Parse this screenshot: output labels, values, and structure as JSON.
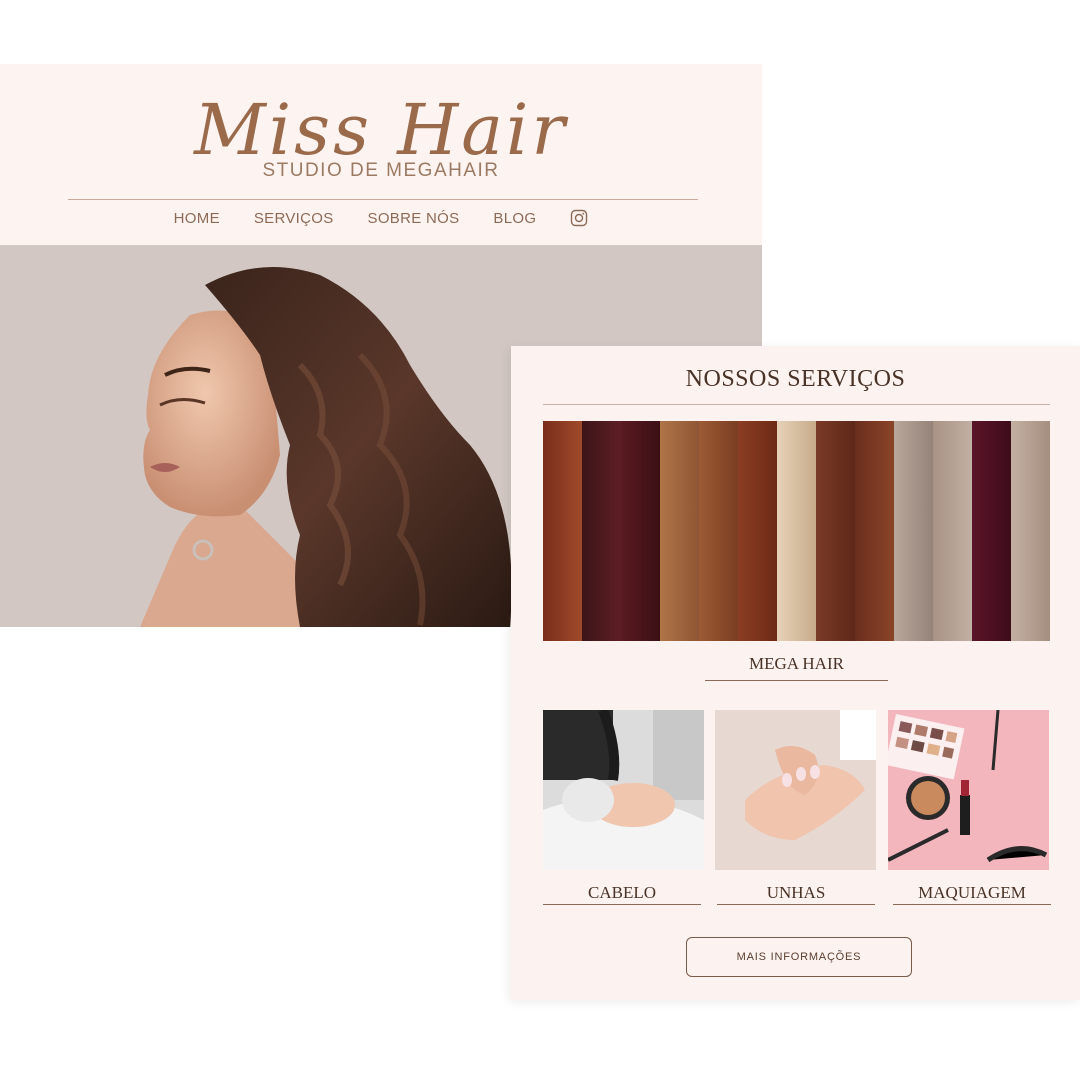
{
  "brand": {
    "script_name": "Miss Hair",
    "tagline": "STUDIO DE MEGAHAIR"
  },
  "nav": {
    "items": [
      "HOME",
      "SERVIÇOS",
      "SOBRE NÓS",
      "BLOG"
    ],
    "social_icon": "instagram-icon"
  },
  "hero": {
    "image": "woman-with-long-wavy-brown-hair-photo"
  },
  "services": {
    "title": "NOSSOS SERVIÇOS",
    "featured": {
      "label": "MEGA HAIR",
      "image": "hair-extension-color-swatches-photo"
    },
    "items": [
      {
        "label": "CABELO",
        "image": "hair-wash-salon-photo"
      },
      {
        "label": "UNHAS",
        "image": "manicure-hands-photo"
      },
      {
        "label": "MAQUIAGEM",
        "image": "makeup-products-flatlay-photo"
      }
    ],
    "more_button": "MAIS INFORMAÇÕES"
  },
  "colors": {
    "page_bg": "#ffffff",
    "card_bg": "#fdf4f2",
    "accent_brown": "#9a6a4a",
    "nav_text": "#8d6a55",
    "heading_text": "#4a3226",
    "hero_bg": "#d2c7c2"
  }
}
